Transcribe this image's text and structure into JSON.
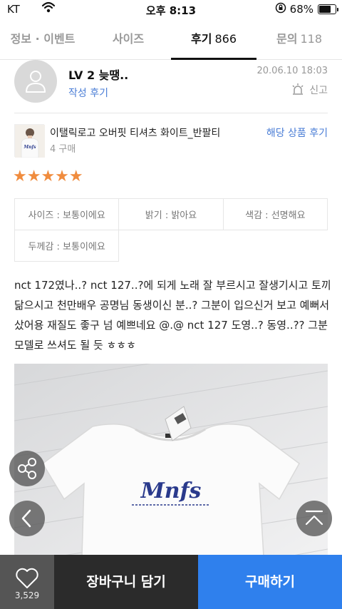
{
  "status_bar": {
    "carrier": "KT",
    "time": "오후 8:13",
    "battery_percent": "68%"
  },
  "tabs": [
    {
      "label": "정보 · 이벤트",
      "count": ""
    },
    {
      "label": "사이즈",
      "count": ""
    },
    {
      "label": "후기",
      "count": "866"
    },
    {
      "label": "문의",
      "count": "118"
    }
  ],
  "review": {
    "user_level": "LV 2 늦땡..",
    "author_link": "작성 후기",
    "date": "20.06.10 18:03",
    "report_label": "신고",
    "rating": 5,
    "stars_text": "★★★★★",
    "text": "nct 172였나..? nct 127..?에 되게 노래 잘 부르시고 잘생기시고 토끼 닮으시고 천만배우 공명님 동생이신 분..? 그분이 입으신거 보고 예뻐서 샀어용 재질도 좋구 넘 예쁘네요 @.@ nct 127 도영..? 동영..?? 그분 모델로 쓰셔도 될 듯 ㅎㅎㅎ"
  },
  "product": {
    "name": "이탤릭로고 오버핏 티셔츠 화이트_반팔티",
    "purchase_count": "4 구매",
    "reviews_link": "해당 상품 후기",
    "thumb_logo": "Mnfs"
  },
  "attributes": {
    "size": "사이즈 : 보통이에요",
    "brightness": "밝기 : 밝아요",
    "color": "색감 : 선명해요",
    "thickness": "두께감 : 보통이에요"
  },
  "photo": {
    "shirt_logo": "Mnfs"
  },
  "bottom_bar": {
    "like_count": "3,529",
    "cart_label": "장바구니 담기",
    "buy_label": "구매하기"
  },
  "colors": {
    "accent_blue": "#2f80ed",
    "link_blue": "#4a7dd6",
    "star_orange": "#f08c3e",
    "cart_dark": "#2b2b2b",
    "like_gray": "#555555",
    "logo_navy": "#2a3a8c"
  }
}
